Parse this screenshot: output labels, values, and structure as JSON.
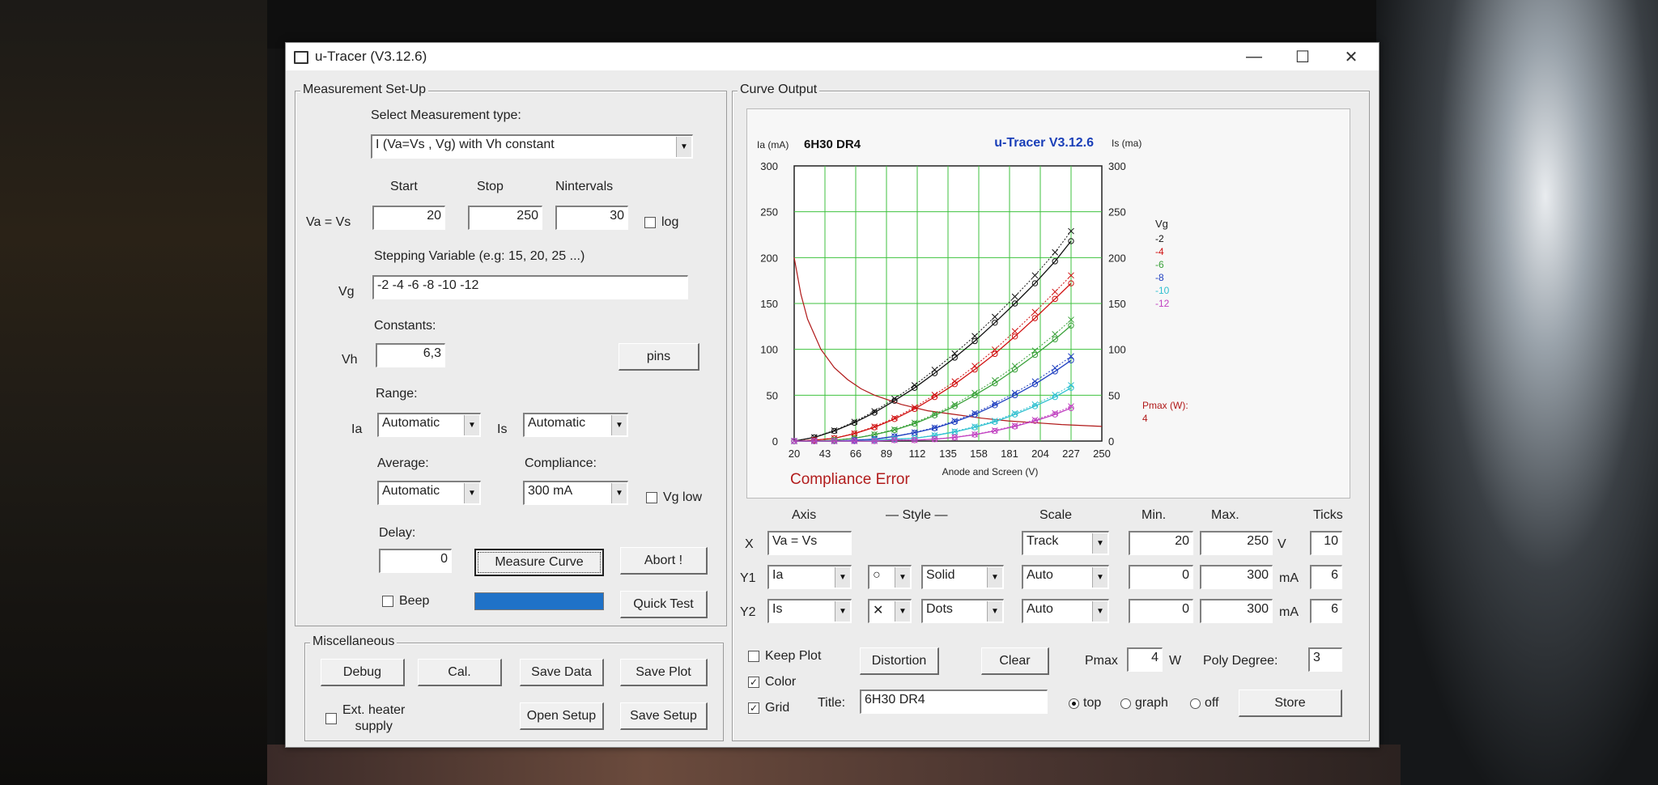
{
  "window": {
    "title": "u-Tracer (V3.12.6)"
  },
  "measurement": {
    "group_label": "Measurement Set-Up",
    "select_type_label": "Select Measurement type:",
    "type_value": "I (Va=Vs , Vg) with Vh constant",
    "start_label": "Start",
    "stop_label": "Stop",
    "nint_label": "Nintervals",
    "va_label": "Va = Vs",
    "start": "20",
    "stop": "250",
    "nint": "30",
    "log_label": "log",
    "stepping_label": "Stepping Variable (e.g: 15, 20, 25 ...)",
    "vg_label": "Vg",
    "vg_value": "-2 -4 -6 -8 -10 -12",
    "constants_label": "Constants:",
    "vh_label": "Vh",
    "vh_value": "6,3",
    "pins_label": "pins",
    "range_label": "Range:",
    "ia_label": "Ia",
    "ia_value": "Automatic",
    "is_label": "Is",
    "is_value": "Automatic",
    "average_label": "Average:",
    "average_value": "Automatic",
    "compliance_label": "Compliance:",
    "compliance_value": "300 mA",
    "vglow_label": "Vg low",
    "delay_label": "Delay:",
    "delay_value": "0",
    "measure_label": "Measure Curve",
    "abort_label": "Abort !",
    "beep_label": "Beep",
    "quicktest_label": "Quick Test",
    "progress": 1.0
  },
  "misc": {
    "group_label": "Miscellaneous",
    "debug": "Debug",
    "cal": "Cal.",
    "save_data": "Save Data",
    "save_plot": "Save Plot",
    "ext_heater_1": "Ext. heater",
    "ext_heater_2": "supply",
    "open_setup": "Open Setup",
    "save_setup": "Save Setup"
  },
  "curve": {
    "group_label": "Curve Output",
    "compliance_error": "Compliance Error",
    "axis_head": "Axis",
    "style_head": "— Style —",
    "scale_head": "Scale",
    "min_head": "Min.",
    "max_head": "Max.",
    "ticks_head": "Ticks",
    "rows": [
      {
        "name": "X",
        "axis": "Va = Vs",
        "scale": "Track",
        "min": "20",
        "max": "250",
        "unit": "V",
        "ticks": "10"
      },
      {
        "name": "Y1",
        "axis": "Ia",
        "marker": "○",
        "line": "Solid",
        "scale": "Auto",
        "min": "0",
        "max": "300",
        "unit": "mA",
        "ticks": "6"
      },
      {
        "name": "Y2",
        "axis": "Is",
        "marker": "✕",
        "line": "Dots",
        "scale": "Auto",
        "min": "0",
        "max": "300",
        "unit": "mA",
        "ticks": "6"
      }
    ],
    "keep_plot": "Keep Plot",
    "color": "Color",
    "grid": "Grid",
    "distortion": "Distortion",
    "clear": "Clear",
    "pmax_label": "Pmax",
    "pmax_value": "4",
    "pmax_unit": "W",
    "poly_label": "Poly Degree:",
    "poly_value": "3",
    "title_label": "Title:",
    "title_value": "6H30 DR4",
    "radio_top": "top",
    "radio_graph": "graph",
    "radio_off": "off",
    "store": "Store"
  },
  "chart_data": {
    "type": "line",
    "title": "6H30 DR4",
    "brand": "u-Tracer V3.12.6",
    "ylabel": "Ia (mA)",
    "y2label": "Is (ma)",
    "xlabel": "Anode and Screen (V)",
    "xlim": [
      20,
      250
    ],
    "ylim": [
      0,
      300
    ],
    "x_ticks": [
      "20",
      "43",
      "66",
      "89",
      "112",
      "135",
      "158",
      "181",
      "204",
      "227",
      "250"
    ],
    "y_ticks": [
      "0",
      "50",
      "100",
      "150",
      "200",
      "250",
      "300"
    ],
    "legend_title": "Vg",
    "pmax_label": "Pmax (W):",
    "pmax_value": "4",
    "x": [
      20,
      35,
      50,
      65,
      80,
      95,
      110,
      125,
      140,
      155,
      170,
      185,
      200,
      215,
      227
    ],
    "series": [
      {
        "name": "-2",
        "color": "#111111",
        "values": [
          0,
          4,
          11,
          20,
          31,
          44,
          58,
          74,
          91,
          109,
          129,
          150,
          172,
          196,
          218
        ]
      },
      {
        "name": "-4",
        "color": "#d01010",
        "values": [
          0,
          1,
          3,
          8,
          15,
          24,
          35,
          48,
          62,
          78,
          95,
          114,
          134,
          155,
          172
        ]
      },
      {
        "name": "-6",
        "color": "#3aa13a",
        "values": [
          0,
          0,
          1,
          3,
          7,
          12,
          19,
          28,
          38,
          50,
          63,
          78,
          94,
          111,
          126
        ]
      },
      {
        "name": "-8",
        "color": "#2040c0",
        "values": [
          0,
          0,
          0,
          1,
          2,
          5,
          9,
          14,
          21,
          29,
          39,
          50,
          62,
          76,
          88
        ]
      },
      {
        "name": "-10",
        "color": "#30c0d0",
        "values": [
          0,
          0,
          0,
          0,
          1,
          2,
          3,
          6,
          10,
          15,
          21,
          29,
          38,
          48,
          58
        ]
      },
      {
        "name": "-12",
        "color": "#c040c0",
        "values": [
          0,
          0,
          0,
          0,
          0,
          1,
          1,
          2,
          4,
          7,
          11,
          16,
          22,
          29,
          36
        ]
      }
    ],
    "pmax_curve": {
      "color": "#b01818",
      "x": [
        20,
        25,
        30,
        40,
        50,
        60,
        70,
        80,
        100,
        120,
        140,
        160,
        180,
        200,
        220,
        250
      ],
      "values": [
        200,
        160,
        133,
        100,
        80,
        67,
        57,
        50,
        40,
        33,
        29,
        25,
        22,
        20,
        18,
        16
      ]
    }
  }
}
